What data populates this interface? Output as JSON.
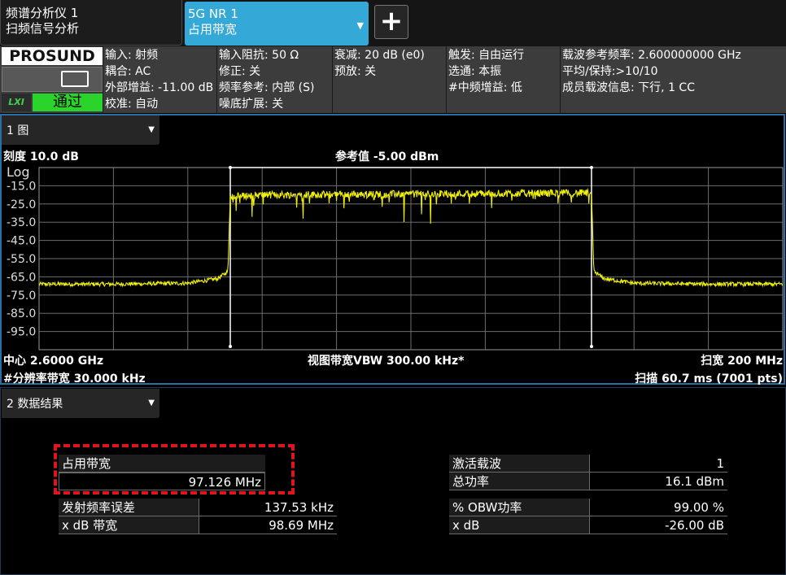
{
  "tabs": {
    "analyzer_line1": "频谱分析仪 1",
    "analyzer_line2": "扫频信号分析",
    "mode_line1": "5G NR 1",
    "mode_line2": "占用带宽",
    "add_label": "+"
  },
  "brand": {
    "logo": "PROSUND",
    "lxi": "LXI",
    "pass": "通过",
    "pass_color": "#2ad42a"
  },
  "info": {
    "col1": [
      "输入: 射频",
      "耦合: AC",
      "外部增益: -11.00 dB",
      "校准: 自动"
    ],
    "col2": [
      "输入阻抗: 50 Ω",
      "修正: 关",
      "频率参考: 内部 (S)",
      "噪底扩展: 关"
    ],
    "col3": [
      "衰减: 20 dB (e0)",
      "预放: 关"
    ],
    "col4": [
      "触发: 自由运行",
      "选通: 本振",
      "#中频增益: 低"
    ],
    "col5": [
      "载波参考频率: 2.600000000 GHz",
      "平均/保持:>10/10",
      "成员载波信息: 下行, 1 CC"
    ]
  },
  "panel1": {
    "tab_label": "1 图",
    "scale_label": "刻度 10.0 dB",
    "ref_label": "参考值 -5.00 dBm",
    "log_label": "Log",
    "center_label": "中心 2.6000 GHz",
    "rbw_label": "#分辨率带宽 30.000 kHz",
    "vbw_label": "视图带宽VBW 300.00 kHz*",
    "span_label": "扫宽 200 MHz",
    "sweep_label": "扫描 60.7 ms (7001 pts)"
  },
  "chart_data": {
    "type": "line",
    "ylabel": "Log",
    "y_ticks": [
      "-15.0",
      "-25.0",
      "-35.0",
      "-45.0",
      "-55.0",
      "-65.0",
      "-75.0",
      "-85.0",
      "-95.0"
    ],
    "ylim": [
      -105,
      -5
    ],
    "xlim": [
      2.5,
      2.7
    ],
    "x_unit": "GHz",
    "grid": true,
    "trace_color": "#f2f200",
    "obw_edges": [
      2.55143,
      2.64857
    ],
    "series": [
      {
        "x": [
          2.5,
          2.52,
          2.54,
          2.548,
          2.5508,
          2.5514,
          2.56,
          2.58,
          2.6,
          2.62,
          2.64,
          2.648,
          2.6486,
          2.6492,
          2.652,
          2.66,
          2.68,
          2.7
        ],
        "values": [
          -69,
          -69,
          -68.5,
          -66,
          -62,
          -21,
          -20,
          -19.8,
          -19.5,
          -19.3,
          -19,
          -19,
          -21,
          -62,
          -66,
          -68.5,
          -69,
          -69
        ]
      }
    ]
  },
  "panel2": {
    "tab_label": "2 数据结果",
    "obw_label": "占用带宽",
    "obw_value": "97.126 MHz",
    "rows_left": [
      {
        "label": "发射频率误差",
        "value": "137.53 kHz"
      },
      {
        "label": "x dB 带宽",
        "value": "98.69 MHz"
      }
    ],
    "rows_right_top": [
      {
        "label": "激活载波",
        "value": "1"
      },
      {
        "label": "总功率",
        "value": "16.1 dBm"
      }
    ],
    "rows_right_bottom": [
      {
        "label": "% OBW功率",
        "value": "99.00 %"
      },
      {
        "label": "x dB",
        "value": "-26.00 dB"
      }
    ]
  }
}
